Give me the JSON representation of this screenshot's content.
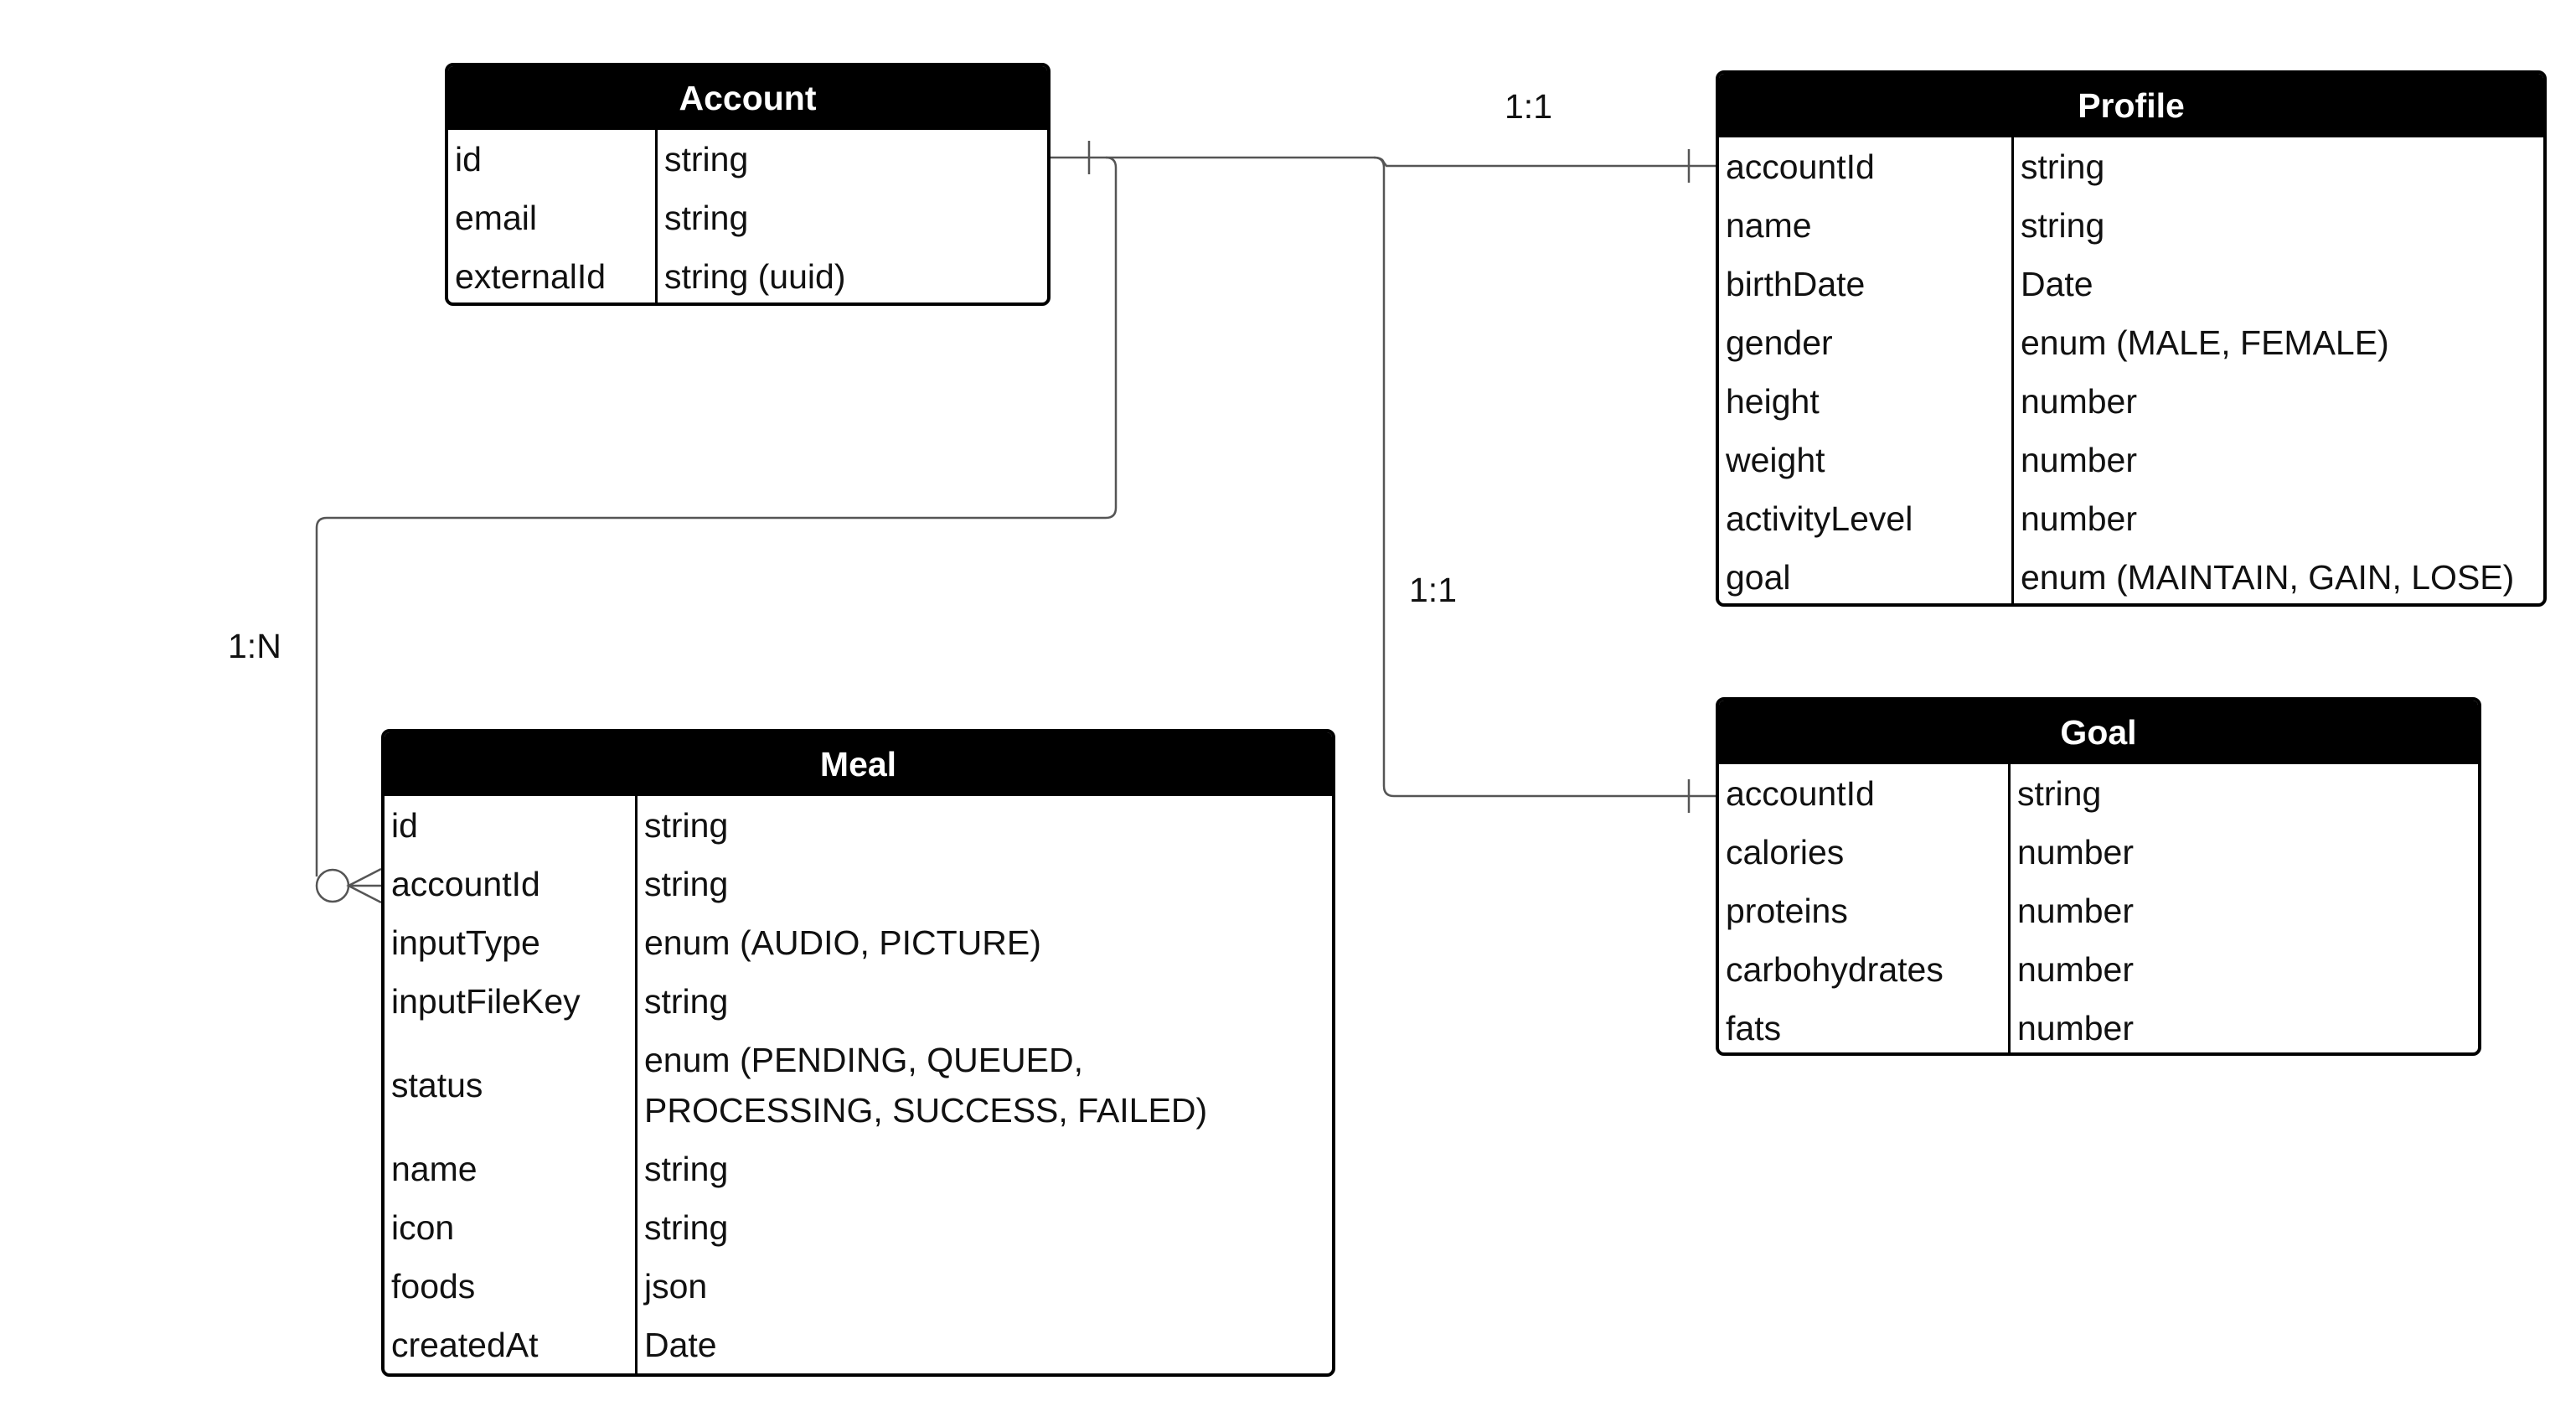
{
  "entities": {
    "account": {
      "title": "Account",
      "fields": [
        {
          "name": "id",
          "type": "string"
        },
        {
          "name": "email",
          "type": "string"
        },
        {
          "name": "externalId",
          "type": "string (uuid)"
        }
      ]
    },
    "profile": {
      "title": "Profile",
      "fields": [
        {
          "name": "accountId",
          "type": "string"
        },
        {
          "name": "name",
          "type": "string"
        },
        {
          "name": "birthDate",
          "type": "Date"
        },
        {
          "name": "gender",
          "type": "enum (MALE, FEMALE)"
        },
        {
          "name": "height",
          "type": "number"
        },
        {
          "name": "weight",
          "type": "number"
        },
        {
          "name": "activityLevel",
          "type": "number"
        },
        {
          "name": "goal",
          "type": "enum (MAINTAIN, GAIN, LOSE)"
        }
      ]
    },
    "goal": {
      "title": "Goal",
      "fields": [
        {
          "name": "accountId",
          "type": "string"
        },
        {
          "name": "calories",
          "type": "number"
        },
        {
          "name": "proteins",
          "type": "number"
        },
        {
          "name": "carbohydrates",
          "type": "number"
        },
        {
          "name": "fats",
          "type": "number"
        }
      ]
    },
    "meal": {
      "title": "Meal",
      "fields": [
        {
          "name": "id",
          "type": "string"
        },
        {
          "name": "accountId",
          "type": "string"
        },
        {
          "name": "inputType",
          "type": "enum (AUDIO, PICTURE)"
        },
        {
          "name": "inputFileKey",
          "type": "string"
        },
        {
          "name": "status",
          "type": "enum (PENDING, QUEUED, PROCESSING, SUCCESS, FAILED)"
        },
        {
          "name": "name",
          "type": "string"
        },
        {
          "name": "icon",
          "type": "string"
        },
        {
          "name": "foods",
          "type": "json"
        },
        {
          "name": "createdAt",
          "type": "Date"
        }
      ]
    }
  },
  "relationships": {
    "account_profile": "1:1",
    "account_goal": "1:1",
    "account_meal": "1:N"
  }
}
